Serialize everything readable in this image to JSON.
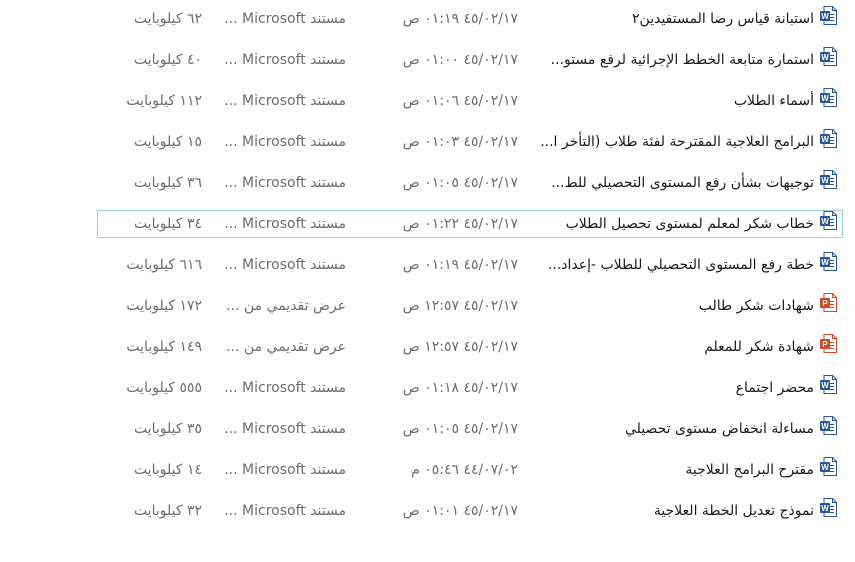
{
  "colors": {
    "word_icon": "#2b579a",
    "powerpoint_icon": "#d24726",
    "selection_border": "#9bd3dc",
    "secondary_text": "#6d6d6d"
  },
  "files": [
    {
      "name": "استبانة قياس رضا المستفيدين٢",
      "date": "٤٥/٠٢/١٧ ٠١:١٩ ص",
      "type": "مستند Microsoft ...",
      "size": "٦٢ كيلوبايت",
      "icon": "word-icon",
      "selected": false
    },
    {
      "name": "استمارة متابعة الخطط الإجرائية لرفع مستو...",
      "date": "٤٥/٠٢/١٧ ٠١:٠٠ ص",
      "type": "مستند Microsoft ...",
      "size": "٤٠ كيلوبايت",
      "icon": "word-icon",
      "selected": false
    },
    {
      "name": "أسماء الطلاب",
      "date": "٤٥/٠٢/١٧ ٠١:٠٦ ص",
      "type": "مستند Microsoft ...",
      "size": "١١٢ كيلوبايت",
      "icon": "word-icon",
      "selected": false
    },
    {
      "name": "البرامج العلاجية المقترحة لفئة طلاب (التأخر ا...",
      "date": "٤٥/٠٢/١٧ ٠١:٠٣ ص",
      "type": "مستند Microsoft ...",
      "size": "١٥ كيلوبايت",
      "icon": "word-icon",
      "selected": false
    },
    {
      "name": "توجيهات بشأن رفع المستوى التحصيلي للط...",
      "date": "٤٥/٠٢/١٧ ٠١:٠٥ ص",
      "type": "مستند Microsoft ...",
      "size": "٣٦ كيلوبايت",
      "icon": "word-icon",
      "selected": false
    },
    {
      "name": "خطاب شكر لمعلم لمستوى تحصيل الطلاب",
      "date": "٤٥/٠٢/١٧ ٠١:٢٢ ص",
      "type": "مستند Microsoft ...",
      "size": "٣٤ كيلوبايت",
      "icon": "word-icon",
      "selected": true
    },
    {
      "name": "خطة رفع المستوى التحصيلي للطلاب -إعداد...",
      "date": "٤٥/٠٢/١٧ ٠١:١٩ ص",
      "type": "مستند Microsoft ...",
      "size": "٦١٦ كيلوبايت",
      "icon": "word-icon",
      "selected": false
    },
    {
      "name": "شهادات شكر طالب",
      "date": "٤٥/٠٢/١٧ ١٢:٥٧ ص",
      "type": "عرض تقديمي من ...",
      "size": "١٧٢ كيلوبايت",
      "icon": "powerpoint-icon",
      "selected": false
    },
    {
      "name": "شهادة شكر للمعلم",
      "date": "٤٥/٠٢/١٧ ١٢:٥٧ ص",
      "type": "عرض تقديمي من ...",
      "size": "١٤٩ كيلوبايت",
      "icon": "powerpoint-icon",
      "selected": false
    },
    {
      "name": "محضر اجتماع",
      "date": "٤٥/٠٢/١٧ ٠١:١٨ ص",
      "type": "مستند Microsoft ...",
      "size": "٥٥٥ كيلوبايت",
      "icon": "word-icon",
      "selected": false
    },
    {
      "name": "مساءلة انخفاض مستوى تحصيلي",
      "date": "٤٥/٠٢/١٧ ٠١:٠٥ ص",
      "type": "مستند Microsoft ...",
      "size": "٣٥ كيلوبايت",
      "icon": "word-icon",
      "selected": false
    },
    {
      "name": "مقترح البرامج العلاجية",
      "date": "٤٤/٠٧/٠٢ ٠٥:٤٦ م",
      "type": "مستند Microsoft ...",
      "size": "١٤ كيلوبايت",
      "icon": "word-icon",
      "selected": false
    },
    {
      "name": "نموذج تعديل الخطة العلاجية",
      "date": "٤٥/٠٢/١٧ ٠١:٠١ ص",
      "type": "مستند Microsoft ...",
      "size": "٣٢ كيلوبايت",
      "icon": "word-icon",
      "selected": false
    }
  ]
}
